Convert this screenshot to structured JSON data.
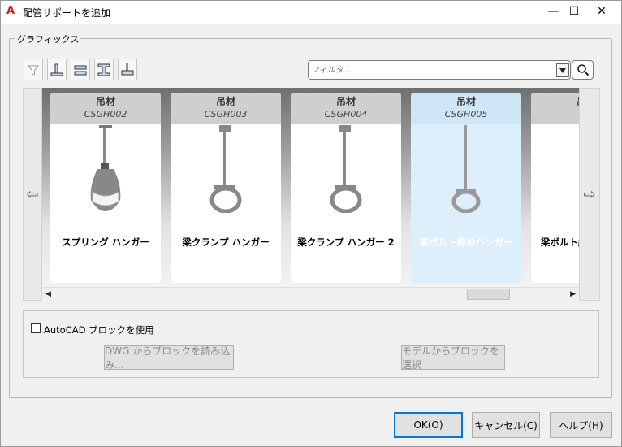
{
  "window": {
    "title": "配管サポートを追加",
    "logo": "A",
    "min_glyph": "—",
    "max_glyph": "☐",
    "close_glyph": "✕"
  },
  "graphics": {
    "group_label": "グラフィックス",
    "filter_placeholder": "フィルタ...",
    "tools": [
      "filter-icon",
      "base-support-icon",
      "beam-support-icon",
      "i-beam-support-icon",
      "pipe-hanger-icon"
    ]
  },
  "gallery": {
    "left_arrow": "⇦",
    "right_arrow": "⇨",
    "cards": [
      {
        "category": "吊材",
        "code": "CSGH002",
        "name": "スプリング ハンガー",
        "icon": "spring-hanger-icon"
      },
      {
        "category": "吊材",
        "code": "CSGH003",
        "name": "梁クランプ ハンガー",
        "icon": "beam-clamp-hanger-icon"
      },
      {
        "category": "吊材",
        "code": "CSGH004",
        "name": "梁クランプ ハンガー 2",
        "icon": "beam-clamp-hanger-2-icon"
      },
      {
        "category": "吊材",
        "code": "CSGH005",
        "name": "梁ボルト締めハンガー",
        "icon": "beam-bolt-hanger-icon"
      },
      {
        "category": "吊材",
        "code": "CS",
        "name": "梁ボルト締",
        "icon": "hanger-icon"
      }
    ],
    "selected_index": 3,
    "scroll_left": "◀",
    "scroll_right": "▶"
  },
  "block": {
    "checkbox_label": "AutoCAD ブロックを使用",
    "checked": false,
    "dwg_button": "DWG からブロックを読み込み...",
    "model_button": "モデルからブロックを選択"
  },
  "footer": {
    "ok": "OK(O)",
    "cancel": "キャンセル(C)",
    "help": "ヘルプ(H)"
  },
  "colors": {
    "logo_red": "#d21f1f",
    "selected_card": "#ddeffb",
    "ok_border": "#0078d7"
  }
}
